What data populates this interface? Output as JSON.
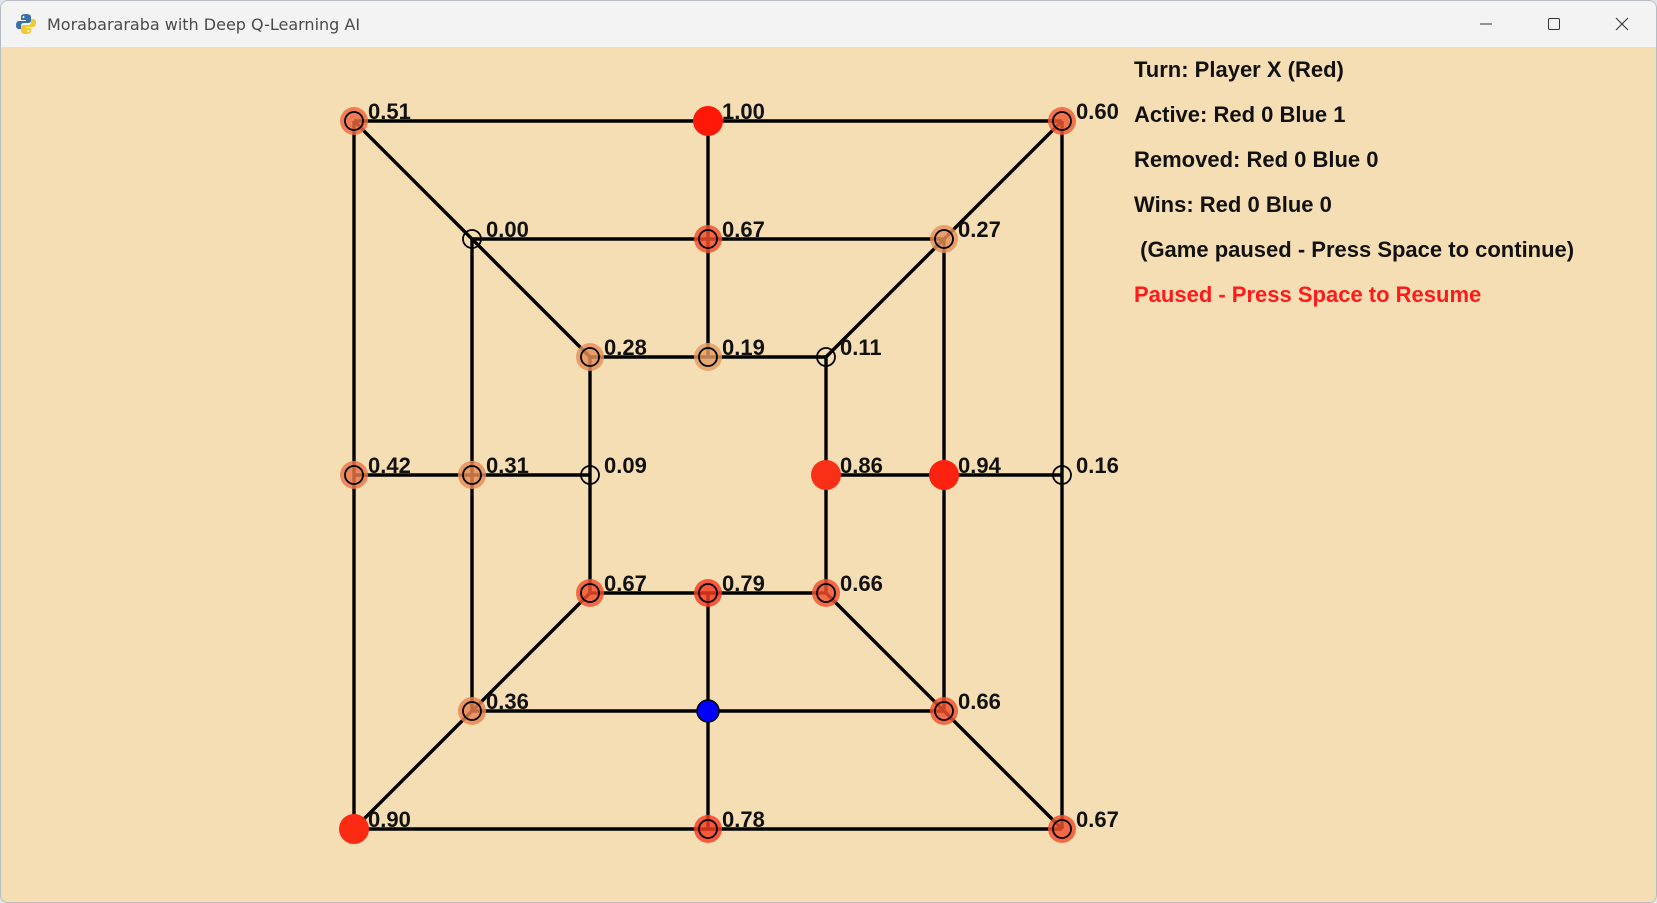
{
  "window": {
    "title": "Morabararaba with Deep Q-Learning AI",
    "icon": "python-icon",
    "controls": [
      "minimize-icon",
      "maximize-icon",
      "close-icon"
    ]
  },
  "info": {
    "turn": "Turn: Player X (Red)",
    "active": "Active: Red 0 Blue 1",
    "removed": "Removed: Red 0 Blue 0",
    "wins": "Wins: Red 0 Blue 0",
    "game_paused": " (Game paused - Press Space to continue)",
    "paused_banner": "Paused - Press Space to Resume"
  },
  "colors": {
    "background": "#f5deb3",
    "line": "#000000",
    "red_piece": "#ff1a0a",
    "blue_piece": "#0000ff",
    "paused_text": "#ff1a1a"
  },
  "board": {
    "points": [
      {
        "id": "a7",
        "q": "0.51",
        "state": "heat"
      },
      {
        "id": "d7",
        "q": "1.00",
        "state": "heat"
      },
      {
        "id": "g7",
        "q": "0.60",
        "state": "heat"
      },
      {
        "id": "b6",
        "q": "0.00",
        "state": "empty"
      },
      {
        "id": "d6",
        "q": "0.67",
        "state": "heat"
      },
      {
        "id": "f6",
        "q": "0.27",
        "state": "heat"
      },
      {
        "id": "c5",
        "q": "0.28",
        "state": "heat"
      },
      {
        "id": "d5",
        "q": "0.19",
        "state": "heat"
      },
      {
        "id": "e5",
        "q": "0.11",
        "state": "empty"
      },
      {
        "id": "a4",
        "q": "0.42",
        "state": "heat"
      },
      {
        "id": "b4",
        "q": "0.31",
        "state": "heat"
      },
      {
        "id": "c4",
        "q": "0.09",
        "state": "empty"
      },
      {
        "id": "e4",
        "q": "0.86",
        "state": "heat"
      },
      {
        "id": "f4",
        "q": "0.94",
        "state": "heat"
      },
      {
        "id": "g4",
        "q": "0.16",
        "state": "empty"
      },
      {
        "id": "c3",
        "q": "0.67",
        "state": "heat"
      },
      {
        "id": "d3",
        "q": "0.79",
        "state": "heat"
      },
      {
        "id": "e3",
        "q": "0.66",
        "state": "heat"
      },
      {
        "id": "b2",
        "q": "0.36",
        "state": "heat"
      },
      {
        "id": "d2",
        "q": "",
        "state": "blue"
      },
      {
        "id": "f2",
        "q": "0.66",
        "state": "heat"
      },
      {
        "id": "a1",
        "q": "0.90",
        "state": "heat"
      },
      {
        "id": "d1",
        "q": "0.78",
        "state": "heat"
      },
      {
        "id": "g1",
        "q": "0.67",
        "state": "heat"
      }
    ]
  }
}
